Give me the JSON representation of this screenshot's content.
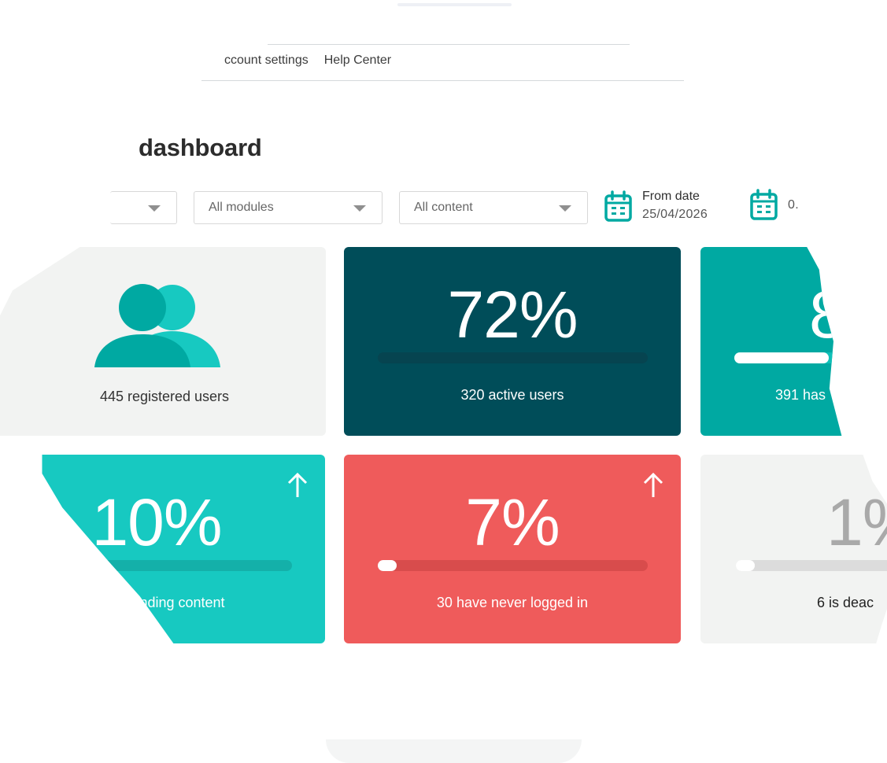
{
  "nav": {
    "items": [
      {
        "label": "ccount settings"
      },
      {
        "label": "Help Center"
      }
    ]
  },
  "page": {
    "title": "dashboard"
  },
  "filters": {
    "selects": [
      {
        "value": ""
      },
      {
        "value": "All modules"
      },
      {
        "value": "All content"
      }
    ],
    "dates": [
      {
        "label": "From date",
        "value": "25/04/2026",
        "icon": "calendar-icon"
      },
      {
        "label": "",
        "value": "0.",
        "icon": "calendar-icon"
      }
    ]
  },
  "cards": {
    "registered": {
      "caption": "445 registered users",
      "icon": "users-icon",
      "color": "#f2f3f2"
    },
    "active": {
      "big": "72%",
      "caption": "320 active users",
      "progress": 0,
      "color": "#004d59"
    },
    "has": {
      "big": "8",
      "caption": "391 has",
      "progress": 0.4,
      "color": "#00a9a2"
    },
    "trending": {
      "big": "10%",
      "caption": "ending content",
      "progress": 0,
      "trend": "up-arrow-icon",
      "color": "#17c9c1"
    },
    "never": {
      "big": "7%",
      "caption": "30 have never logged in",
      "progress": 0.07,
      "trend": "up-arrow-icon",
      "color": "#ef5b5b"
    },
    "deac": {
      "big": "1%",
      "caption": "6 is deac",
      "progress": 0.01,
      "color": "#f2f3f2"
    }
  }
}
